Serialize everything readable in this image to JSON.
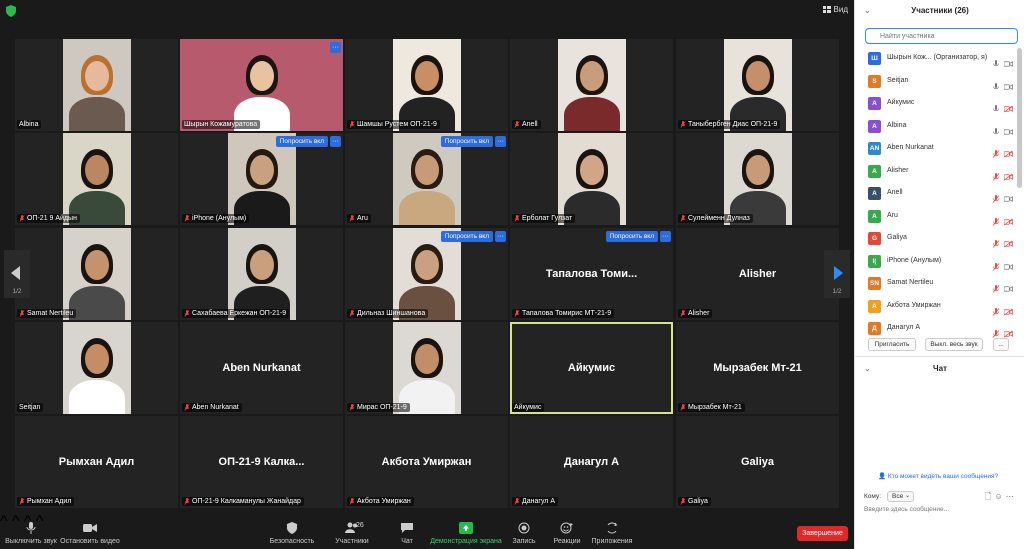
{
  "topbar": {
    "view_label": "Вид"
  },
  "pager": {
    "left": "1/2",
    "right": "1/2"
  },
  "tiles": [
    {
      "label": "Albina",
      "mic": "on",
      "photo": {
        "bg": "#cfc8c0",
        "skin": "#e6b89c",
        "hair": "#b8712e",
        "shirt": "#6a5a50"
      }
    },
    {
      "label": "Шырын Кожамуратова",
      "mic": "on",
      "photo": {
        "bg": "#b85a6e",
        "skin": "#e9c2a0",
        "hair": "#1c1410",
        "shirt": "#ffffff"
      },
      "more": true
    },
    {
      "label": "Шамшы Рустем ОП-21-9",
      "mic": "off",
      "photo": {
        "bg": "#efe8de",
        "skin": "#c98f64",
        "hair": "#1a1410",
        "shirt": "#222222"
      }
    },
    {
      "label": "Anell",
      "mic": "off",
      "photo": {
        "bg": "#e8e3dd",
        "skin": "#c99c7b",
        "hair": "#1c1410",
        "shirt": "#7a2a2a"
      }
    },
    {
      "label": "Таныбербген Диас ОП-21-9",
      "mic": "off",
      "photo": {
        "bg": "#e7e2da",
        "skin": "#c48f6a",
        "hair": "#1a1410",
        "shirt": "#2a2a2a"
      }
    },
    {
      "label": "ОП-21 9 Айдын",
      "mic": "off",
      "photo": {
        "bg": "#d9d6c8",
        "skin": "#bb8762",
        "hair": "#1a1410",
        "shirt": "#3a4a3a"
      }
    },
    {
      "label": "iPhone (Анулым)",
      "mic": "off",
      "photo": {
        "bg": "#cfc6bc",
        "skin": "#c9a080",
        "hair": "#241810",
        "shirt": "#1a1a1a"
      },
      "ask": true
    },
    {
      "label": "Aru",
      "mic": "off",
      "photo": {
        "bg": "#cfcac0",
        "skin": "#c89b78",
        "hair": "#2a1c12",
        "shirt": "#c9a880"
      },
      "ask": true
    },
    {
      "label": "Ерболат Гулзат",
      "mic": "off",
      "photo": {
        "bg": "#e2dcd3",
        "skin": "#d1a688",
        "hair": "#1a1410",
        "shirt": "#2b2b2b"
      }
    },
    {
      "label": "Сулейменн Дулназ",
      "mic": "off",
      "photo": {
        "bg": "#dcd8d2",
        "skin": "#c99a78",
        "hair": "#1c1410",
        "shirt": "#3a3a3a"
      }
    },
    {
      "label": "Samat Nertileu",
      "mic": "off",
      "photo": {
        "bg": "#d6d2ca",
        "skin": "#c4926c",
        "hair": "#1a1410",
        "shirt": "#4a4a4a"
      }
    },
    {
      "label": "Сахабаева Еркежан ОП-21-9",
      "mic": "off",
      "photo": {
        "bg": "#d2cfc8",
        "skin": "#c99f7d",
        "hair": "#1a1410",
        "shirt": "#1f1f1f"
      }
    },
    {
      "label": "Дильназ Шиншанова",
      "mic": "off",
      "photo": {
        "bg": "#e2ded7",
        "skin": "#c9a080",
        "hair": "#2a1c12",
        "shirt": "#6a5040"
      },
      "ask": true
    },
    {
      "label": "Тапалова Томирис МТ-21-9",
      "mic": "off",
      "name": "Тапалова  Томи...",
      "ask": true
    },
    {
      "label": "Alisher",
      "mic": "off",
      "name": "Alisher"
    },
    {
      "label": "Seitjan",
      "mic": "on",
      "photo": {
        "bg": "#d8d5cf",
        "skin": "#c48d66",
        "hair": "#1a1410",
        "shirt": "#ffffff"
      }
    },
    {
      "label": "Aben Nurkanat",
      "mic": "off",
      "name": "Aben Nurkanat"
    },
    {
      "label": "Мирас ОП-21-9",
      "mic": "off",
      "photo": {
        "bg": "#dcd9d4",
        "skin": "#c18e68",
        "hair": "#1a1410",
        "shirt": "#f2f2f2"
      }
    },
    {
      "label": "Айкумис",
      "mic": "on",
      "name": "Айкумис",
      "active": true
    },
    {
      "label": "Мырзабек Мт-21",
      "mic": "off",
      "name": "Мырзабек Мт-21"
    },
    {
      "label": "Рымхан Адил",
      "mic": "off",
      "name": "Рымхан Адил"
    },
    {
      "label": "ОП-21-9 Калкаманулы Жанайдар",
      "mic": "off",
      "name": "ОП-21-9  Калка..."
    },
    {
      "label": "Акбота Умиржан",
      "mic": "off",
      "name": "Акбота Умиржан"
    },
    {
      "label": "Данагул А",
      "mic": "off",
      "name": "Данагул А"
    },
    {
      "label": "Galiya",
      "mic": "off",
      "name": "Galiya"
    }
  ],
  "ask_label": "Попросить вкл",
  "more_label": "···",
  "toolbar": {
    "mute": "Выключить звук",
    "video": "Остановить видео",
    "security": "Безопасность",
    "participants": "Участники",
    "participants_count": "26",
    "chat": "Чат",
    "share": "Демонстрация экрана",
    "record": "Запись",
    "reactions": "Реакции",
    "apps": "Приложения",
    "end": "Завершение"
  },
  "panel": {
    "title": "Участники (26)",
    "search_placeholder": "Найти участника",
    "invite": "Пригласить",
    "mute_all": "Выкл. весь звук",
    "more": "...",
    "chat_title": "Чат",
    "who_sees": "Кто может видеть ваши сообщения?",
    "to_label": "Кому:",
    "to_value": "Все",
    "chat_placeholder": "Введите здесь сообщение..."
  },
  "participants": [
    {
      "initials": "Ш",
      "color": "#2d6ce0",
      "name": "Шырын Кож...  (Организатор, я)",
      "mic": "on",
      "video": "on"
    },
    {
      "initials": "S",
      "color": "#e07a28",
      "name": "Seitjan",
      "mic": "on",
      "video": "on"
    },
    {
      "initials": "А",
      "color": "#8a4fd1",
      "name": "Айкумис",
      "mic": "on",
      "video": "off"
    },
    {
      "initials": "A",
      "color": "#8a4fd1",
      "name": "Albina",
      "mic": "on",
      "video": "on"
    },
    {
      "initials": "AN",
      "color": "#2d8cc8",
      "name": "Aben Nurkanat",
      "mic": "off",
      "video": "off"
    },
    {
      "initials": "A",
      "color": "#3aa84c",
      "name": "Alisher",
      "mic": "off",
      "video": "off"
    },
    {
      "initials": "A",
      "color": "#3a4f6a",
      "name": "Anell",
      "mic": "off",
      "video": "on"
    },
    {
      "initials": "A",
      "color": "#3aa84c",
      "name": "Aru",
      "mic": "off",
      "video": "off"
    },
    {
      "initials": "G",
      "color": "#e04a3a",
      "name": "Galiya",
      "mic": "off",
      "video": "off"
    },
    {
      "initials": "I(",
      "color": "#3aa84c",
      "name": "iPhone (Анулым)",
      "mic": "off",
      "video": "on"
    },
    {
      "initials": "SN",
      "color": "#e07a28",
      "name": "Samat Nertileu",
      "mic": "off",
      "video": "on"
    },
    {
      "initials": "А",
      "color": "#f0a020",
      "name": "Акбота Умиржан",
      "mic": "off",
      "video": "off"
    },
    {
      "initials": "Д",
      "color": "#e07a28",
      "name": "Данагул А",
      "mic": "off",
      "video": "off"
    }
  ]
}
